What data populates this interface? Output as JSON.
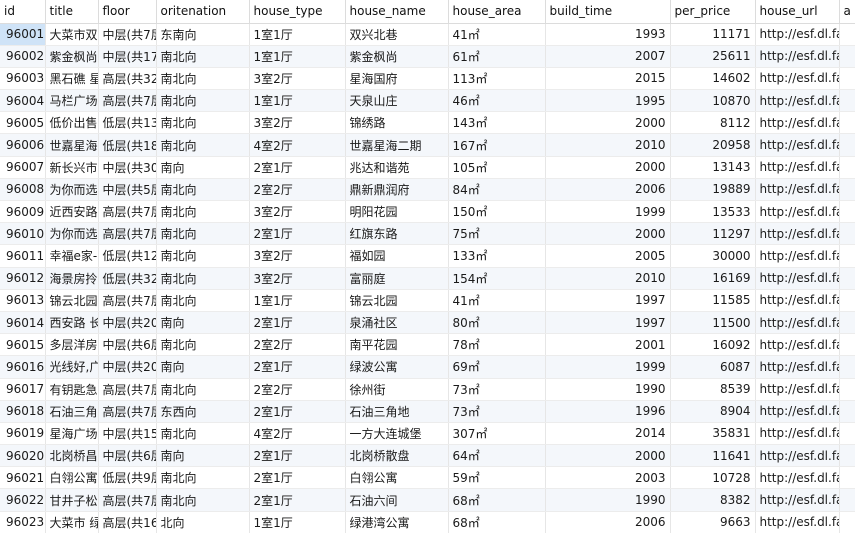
{
  "columns": [
    "id",
    "title",
    "floor",
    "oritenation",
    "house_type",
    "house_name",
    "house_area",
    "build_time",
    "per_price",
    "house_url",
    "a"
  ],
  "rows": [
    [
      "96001",
      "大菜市双",
      "中层(共7层",
      "东南向",
      "1室1厅",
      "双兴北巷",
      "41㎡",
      "1993",
      "11171",
      "http://esf.dl.fang",
      ""
    ],
    [
      "96002",
      "紫金枫尚",
      "中层(共17",
      "南北向",
      "1室1厅",
      "紫金枫尚",
      "61㎡",
      "2007",
      "25611",
      "http://esf.dl.fang",
      ""
    ],
    [
      "96003",
      "黑石礁 星",
      "高层(共32",
      "南北向",
      "3室2厅",
      "星海国府",
      "113㎡",
      "2015",
      "14602",
      "http://esf.dl.fang",
      ""
    ],
    [
      "96004",
      "马栏广场",
      "高层(共7层",
      "南北向",
      "1室1厅",
      "天泉山庄",
      "46㎡",
      "1995",
      "10870",
      "http://esf.dl.fang",
      ""
    ],
    [
      "96005",
      "低价出售",
      "低层(共13",
      "南北向",
      "3室2厅",
      "锦绣路",
      "143㎡",
      "2000",
      "8112",
      "http://esf.dl.fang",
      ""
    ],
    [
      "96006",
      "世嘉星海",
      "低层(共18",
      "南北向",
      "4室2厅",
      "世嘉星海二期",
      "167㎡",
      "2010",
      "20958",
      "http://esf.dl.fang",
      ""
    ],
    [
      "96007",
      "新长兴市",
      "中层(共30",
      "南向",
      "2室1厅",
      "兆达和谐苑",
      "105㎡",
      "2000",
      "13143",
      "http://esf.dl.fang",
      ""
    ],
    [
      "96008",
      "为你而选",
      "中层(共5层",
      "南北向",
      "2室2厅",
      "鼎新鼎润府",
      "84㎡",
      "2006",
      "19889",
      "http://esf.dl.fang",
      ""
    ],
    [
      "96009",
      "近西安路",
      "高层(共7层",
      "南北向",
      "3室2厅",
      "明阳花园",
      "150㎡",
      "1999",
      "13533",
      "http://esf.dl.fang",
      ""
    ],
    [
      "96010",
      "为你而选",
      "高层(共7层",
      "南北向",
      "2室1厅",
      "红旗东路",
      "75㎡",
      "2000",
      "11297",
      "http://esf.dl.fang",
      ""
    ],
    [
      "96011",
      "幸福e家-",
      "低层(共12",
      "南北向",
      "3室2厅",
      "福如园",
      "133㎡",
      "2005",
      "30000",
      "http://esf.dl.fang",
      ""
    ],
    [
      "96012",
      "海景房拎",
      "低层(共32",
      "南北向",
      "3室2厅",
      "富丽庭",
      "154㎡",
      "2010",
      "16169",
      "http://esf.dl.fang",
      ""
    ],
    [
      "96013",
      "锦云北园",
      "高层(共7层",
      "南北向",
      "1室1厅",
      "锦云北园",
      "41㎡",
      "1997",
      "11585",
      "http://esf.dl.fang",
      ""
    ],
    [
      "96014",
      "西安路 长",
      "中层(共20",
      "南向",
      "2室1厅",
      "泉涌社区",
      "80㎡",
      "1997",
      "11500",
      "http://esf.dl.fang",
      ""
    ],
    [
      "96015",
      "多层洋房",
      "中层(共6层",
      "南北向",
      "2室2厅",
      "南平花园",
      "78㎡",
      "2001",
      "16092",
      "http://esf.dl.fang",
      ""
    ],
    [
      "96016",
      "光线好,广",
      "中层(共20",
      "南向",
      "2室1厅",
      "绿波公寓",
      "69㎡",
      "1999",
      "6087",
      "http://esf.dl.fang",
      ""
    ],
    [
      "96017",
      "有钥匙急",
      "高层(共7层",
      "南北向",
      "2室2厅",
      "徐州街",
      "73㎡",
      "1990",
      "8539",
      "http://esf.dl.fang",
      ""
    ],
    [
      "96018",
      "石油三角",
      "高层(共7层",
      "东西向",
      "2室1厅",
      "石油三角地",
      "73㎡",
      "1996",
      "8904",
      "http://esf.dl.fang",
      ""
    ],
    [
      "96019",
      "星海广场",
      "中层(共15",
      "南北向",
      "4室2厅",
      "一方大连城堡",
      "307㎡",
      "2014",
      "35831",
      "http://esf.dl.fang",
      ""
    ],
    [
      "96020",
      "北岗桥昌",
      "中层(共6层",
      "南向",
      "2室1厅",
      "北岗桥散盘",
      "64㎡",
      "2000",
      "11641",
      "http://esf.dl.fang",
      ""
    ],
    [
      "96021",
      "白翎公寓",
      "低层(共9层",
      "南北向",
      "2室1厅",
      "白翎公寓",
      "59㎡",
      "2003",
      "10728",
      "http://esf.dl.fang",
      ""
    ],
    [
      "96022",
      "甘井子松",
      "高层(共7层",
      "南北向",
      "2室1厅",
      "石油六间",
      "68㎡",
      "1990",
      "8382",
      "http://esf.dl.fang",
      ""
    ],
    [
      "96023",
      "大菜市 绿",
      "高层(共16",
      "北向",
      "1室1厅",
      "绿港湾公寓",
      "68㎡",
      "2006",
      "9663",
      "http://esf.dl.fang",
      ""
    ]
  ],
  "selected_row": 0,
  "colors": {
    "header_bg": "#ffffff",
    "row_alt_bg": "#f4f7fb",
    "selected_cell_bg": "#cfe3f7",
    "grid_line": "#e6e6e6"
  }
}
